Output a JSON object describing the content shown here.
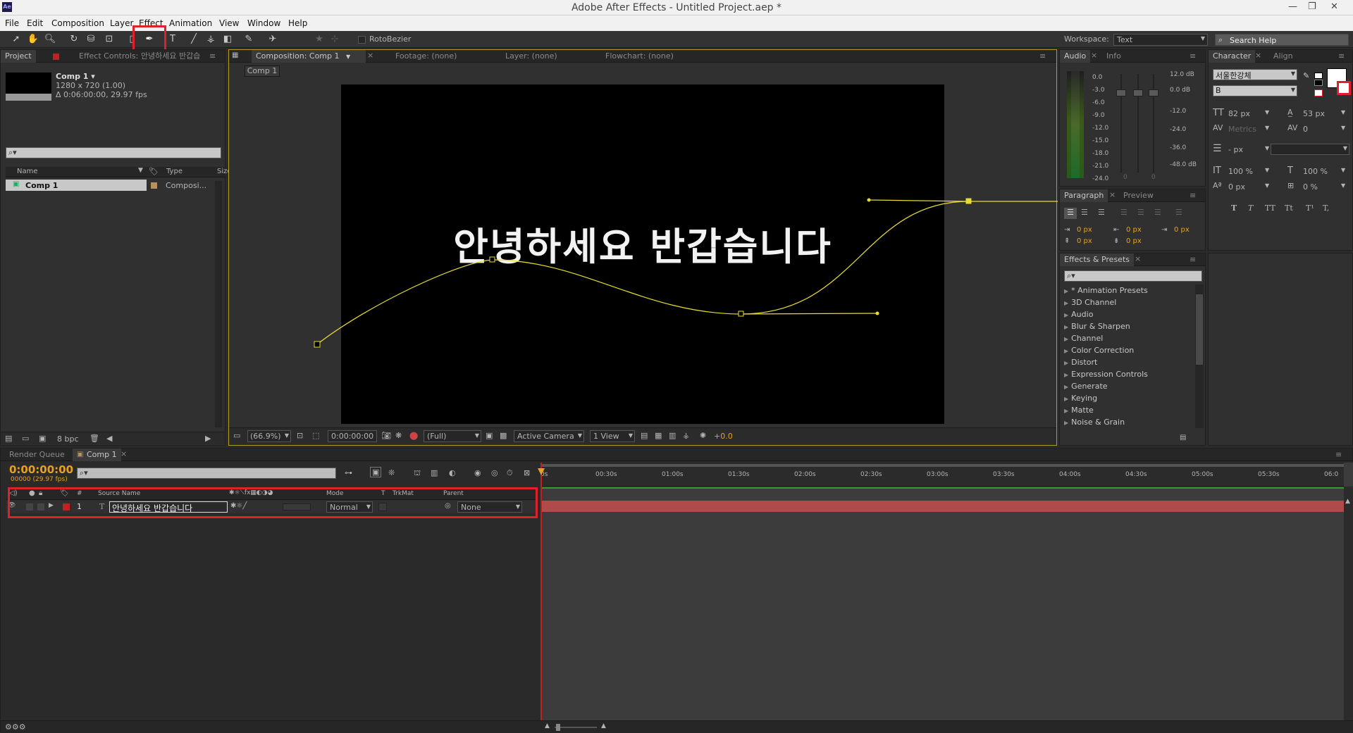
{
  "window": {
    "title": "Adobe After Effects - Untitled Project.aep *",
    "icon": "Ae"
  },
  "menu": [
    "File",
    "Edit",
    "Composition",
    "Layer",
    "Effect",
    "Animation",
    "View",
    "Window",
    "Help"
  ],
  "toolbar": {
    "rotobezier": "RotoBezier",
    "workspace_label": "Workspace:",
    "workspace_value": "Text",
    "search_placeholder": "Search Help"
  },
  "project": {
    "tab_project": "Project",
    "tab_effect_controls": "Effect Controls: 안녕하세요 반갑습",
    "comp_name": "Comp 1 ▾",
    "comp_size": "1280 x 720 (1.00)",
    "comp_duration": "Δ 0:06:00:00, 29.97 fps",
    "col_name": "Name",
    "col_type": "Type",
    "col_size": "Size",
    "item_name": "Comp 1",
    "item_type": "Composi...",
    "bpc": "8 bpc"
  },
  "viewer": {
    "tab_composition": "Composition: Comp 1",
    "tab_footage": "Footage: (none)",
    "tab_layer": "Layer: (none)",
    "tab_flowchart": "Flowchart: (none)",
    "comp_button": "Comp 1",
    "text": "안녕하세요 반갑습니다",
    "zoom": "(66.9%)",
    "timecode": "0:00:00:00",
    "resolution": "(Full)",
    "camera": "Active Camera",
    "views": "1 View",
    "exposure": "+0.0"
  },
  "audio": {
    "tab_audio": "Audio",
    "tab_info": "Info",
    "left_scale": [
      "0.0",
      "-3.0",
      "-6.0",
      "-9.0",
      "-12.0",
      "-15.0",
      "-18.0",
      "-21.0",
      "-24.0"
    ],
    "right_scale": [
      "12.0 dB",
      "0.0 dB",
      "-12.0",
      "-24.0",
      "-36.0",
      "-48.0 dB"
    ],
    "zero_a": "0",
    "zero_b": "0"
  },
  "paragraph": {
    "tab_paragraph": "Paragraph",
    "tab_preview": "Preview",
    "indent_left": "0 px",
    "indent_right": "0 px",
    "indent_first": "0 px",
    "space_before": "0 px",
    "space_after": "0 px"
  },
  "effects": {
    "tab": "Effects & Presets",
    "items": [
      "* Animation Presets",
      "3D Channel",
      "Audio",
      "Blur & Sharpen",
      "Channel",
      "Color Correction",
      "Distort",
      "Expression Controls",
      "Generate",
      "Keying",
      "Matte",
      "Noise & Grain"
    ]
  },
  "character": {
    "tab_character": "Character",
    "tab_align": "Align",
    "font": "서울한강체",
    "style": "B",
    "size": "82 px",
    "leading": "53 px",
    "kerning": "Metrics",
    "tracking": "0",
    "stroke_width": "- px",
    "vscale": "100 %",
    "hscale": "100 %",
    "baseline": "0 px",
    "tsume": "0 %",
    "styles": [
      "T",
      "T",
      "TT",
      "Tt",
      "T¹",
      "T,"
    ]
  },
  "timeline": {
    "tab_render": "Render Queue",
    "tab_comp": "Comp 1",
    "timecode": "0:00:00:00",
    "frames": "00000 (29.97 fps)",
    "col_num": "#",
    "col_source": "Source Name",
    "col_mode": "Mode",
    "col_t": "T",
    "col_trkmat": "TrkMat",
    "col_parent": "Parent",
    "layer_num": "1",
    "layer_name": "안녕하세요 반갑습니다",
    "layer_mode": "Normal",
    "layer_parent": "None",
    "ruler": [
      "0s",
      "00:30s",
      "01:00s",
      "01:30s",
      "02:00s",
      "02:30s",
      "03:00s",
      "03:30s",
      "04:00s",
      "04:30s",
      "05:00s",
      "05:30s",
      "06:0"
    ]
  },
  "colors": {
    "accent": "#e8a022",
    "highlight": "#e0202a",
    "path": "#e6dc32"
  }
}
